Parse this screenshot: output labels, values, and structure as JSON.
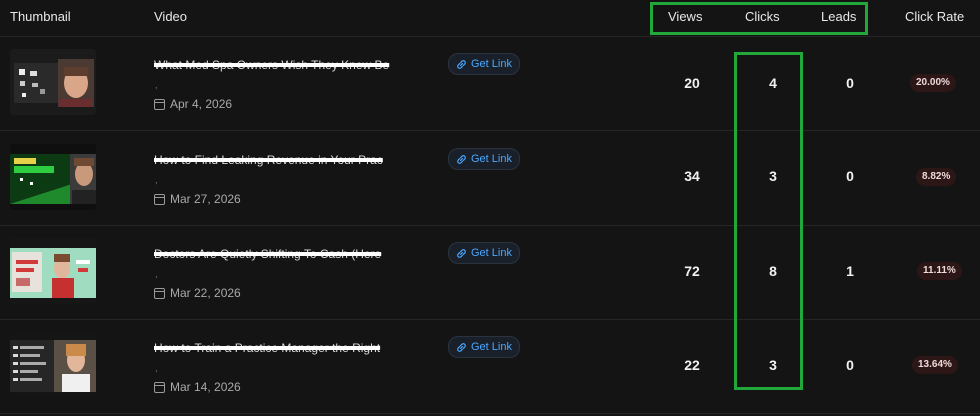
{
  "header": {
    "thumbnail": "Thumbnail",
    "video": "Video",
    "views": "Views",
    "clicks": "Clicks",
    "leads": "Leads",
    "click_rate": "Click Rate"
  },
  "get_link_label": "Get Link",
  "rows": [
    {
      "title": "What Med Spa Owners Wish They Knew Be",
      "date": "Apr 4, 2026",
      "views": "20",
      "clicks": "4",
      "leads": "0",
      "click_rate": "20.00%"
    },
    {
      "title": "How to Find Leaking Revenue in Your Prac",
      "date": "Mar 27, 2026",
      "views": "34",
      "clicks": "3",
      "leads": "0",
      "click_rate": "8.82%"
    },
    {
      "title": "Doctors Are Quietly Shifting To Cash (Here",
      "date": "Mar 22, 2026",
      "views": "72",
      "clicks": "8",
      "leads": "1",
      "click_rate": "11.11%"
    },
    {
      "title": "How to Train a Practice Manager the Right",
      "date": "Mar 14, 2026",
      "views": "22",
      "clicks": "3",
      "leads": "0",
      "click_rate": "13.64%"
    }
  ],
  "colors": {
    "background": "#141414",
    "accent_link": "#4aa8ff",
    "highlight_box": "#22a83a",
    "rate_badge": "#2d1616"
  }
}
